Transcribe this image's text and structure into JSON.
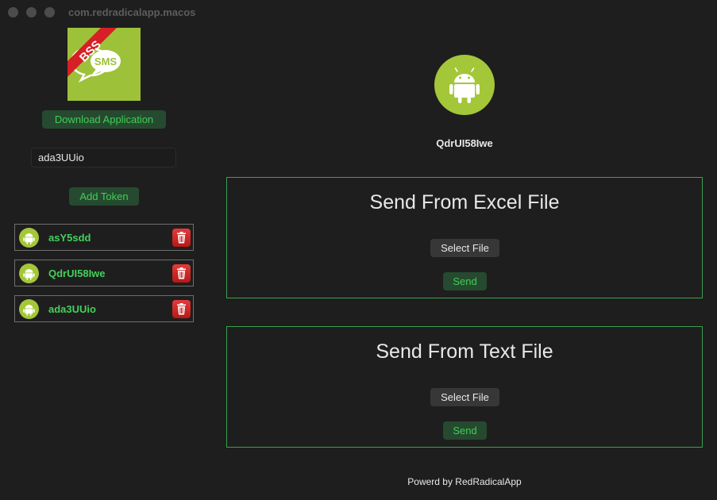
{
  "window": {
    "title": "com.redradicalapp.macos"
  },
  "sidebar": {
    "logo": {
      "ribbon": "BSS",
      "badge": "SMS",
      "background": "#9ec13a",
      "ribbon_color": "#d61f26"
    },
    "download_button": "Download Application",
    "token_input": {
      "value": "ada3UUio"
    },
    "add_token_button": "Add Token",
    "tokens": [
      {
        "name": "asY5sdd"
      },
      {
        "name": "QdrUI58Iwe"
      },
      {
        "name": "ada3UUio"
      }
    ]
  },
  "main": {
    "device": {
      "icon": "android-icon",
      "name": "QdrUI58Iwe"
    },
    "excel_panel": {
      "heading": "Send From Excel File",
      "select_button": "Select File",
      "send_button": "Send"
    },
    "text_panel": {
      "heading": "Send From Text File",
      "select_button": "Select File",
      "send_button": "Send"
    }
  },
  "footer": {
    "text": "Powerd by RedRadicalApp"
  },
  "colors": {
    "accent": "#3fcf56",
    "panel_border": "#3aa04f",
    "android": "#a4c639",
    "delete": "#d42a2a"
  }
}
